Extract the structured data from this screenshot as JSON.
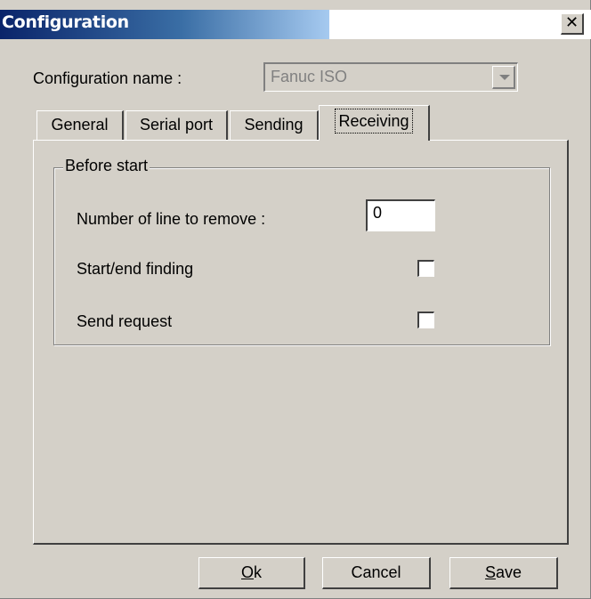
{
  "window": {
    "title": "Configuration",
    "close_glyph": "✕"
  },
  "config_name": {
    "label": "Configuration name :",
    "value": "Fanuc ISO"
  },
  "tabs": [
    {
      "label": "General",
      "active": false
    },
    {
      "label": "Serial port",
      "active": false
    },
    {
      "label": "Sending",
      "active": false
    },
    {
      "label": "Receiving",
      "active": true
    }
  ],
  "before_start": {
    "group_label": "Before start",
    "lines_to_remove_label": "Number of line to remove :",
    "lines_to_remove_value": "0",
    "start_end_label": "Start/end finding",
    "start_end_checked": false,
    "send_request_label": "Send request",
    "send_request_checked": false
  },
  "buttons": {
    "ok_mnemonic": "O",
    "ok_rest": "k",
    "cancel": "Cancel",
    "save_mnemonic": "S",
    "save_rest": "ave"
  }
}
